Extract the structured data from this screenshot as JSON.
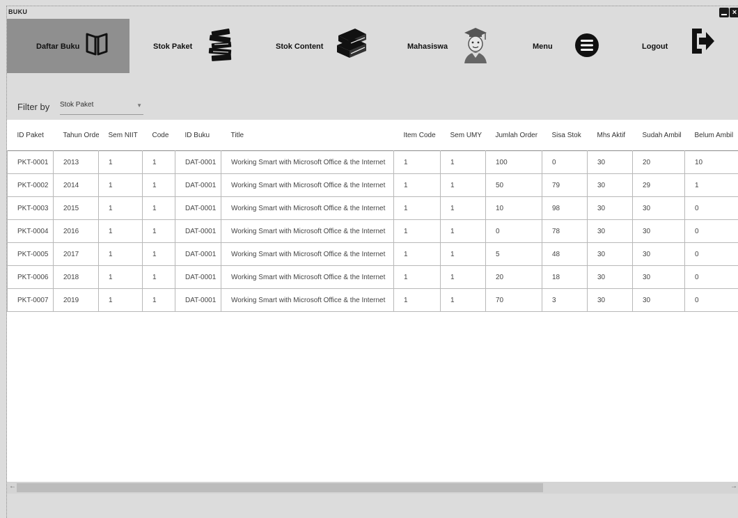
{
  "window": {
    "title": "BUKU"
  },
  "nav": [
    {
      "label": "Daftar Buku",
      "icon": "open-book-icon",
      "active": true
    },
    {
      "label": "Stok Paket",
      "icon": "book-stack-icon",
      "active": false
    },
    {
      "label": "Stok Content",
      "icon": "books-icon",
      "active": false
    },
    {
      "label": "Mahasiswa",
      "icon": "graduate-student-icon",
      "active": false
    },
    {
      "label": "Menu",
      "icon": "hamburger-menu-icon",
      "active": false
    },
    {
      "label": "Logout",
      "icon": "logout-icon",
      "active": false
    }
  ],
  "filter": {
    "label": "Filter by",
    "selected": "Stok Paket"
  },
  "table": {
    "columns": [
      "ID Paket",
      "Tahun Order",
      "Sem NIIT",
      "Code",
      "ID Buku",
      "Title",
      "Item Code",
      "Sem UMY",
      "Jumlah Order",
      "Sisa Stok",
      "Mhs Aktif",
      "Sudah Ambil",
      "Belum Ambil"
    ],
    "rows": [
      [
        "PKT-0001",
        "2013",
        "1",
        "1",
        "DAT-0001",
        "Working Smart with Microsoft Office & the Internet",
        "1",
        "1",
        "100",
        "0",
        "30",
        "20",
        "10"
      ],
      [
        "PKT-0002",
        "2014",
        "1",
        "1",
        "DAT-0001",
        "Working Smart with Microsoft Office & the Internet",
        "1",
        "1",
        "50",
        "79",
        "30",
        "29",
        "1"
      ],
      [
        "PKT-0003",
        "2015",
        "1",
        "1",
        "DAT-0001",
        "Working Smart with Microsoft Office & the Internet",
        "1",
        "1",
        "10",
        "98",
        "30",
        "30",
        "0"
      ],
      [
        "PKT-0004",
        "2016",
        "1",
        "1",
        "DAT-0001",
        "Working Smart with Microsoft Office & the Internet",
        "1",
        "1",
        "0",
        "78",
        "30",
        "30",
        "0"
      ],
      [
        "PKT-0005",
        "2017",
        "1",
        "1",
        "DAT-0001",
        "Working Smart with Microsoft Office & the Internet",
        "1",
        "1",
        "5",
        "48",
        "30",
        "30",
        "0"
      ],
      [
        "PKT-0006",
        "2018",
        "1",
        "1",
        "DAT-0001",
        "Working Smart with Microsoft Office & the Internet",
        "1",
        "1",
        "20",
        "18",
        "30",
        "30",
        "0"
      ],
      [
        "PKT-0007",
        "2019",
        "1",
        "1",
        "DAT-0001",
        "Working Smart with Microsoft Office & the Internet",
        "1",
        "1",
        "70",
        "3",
        "30",
        "30",
        "0"
      ]
    ]
  },
  "scrollbar": {
    "left_arrow": "←",
    "right_arrow": "→"
  },
  "colors": {
    "active_nav": "#8f8f8f",
    "background": "#dcdcdc",
    "table_bg": "#ffffff"
  }
}
